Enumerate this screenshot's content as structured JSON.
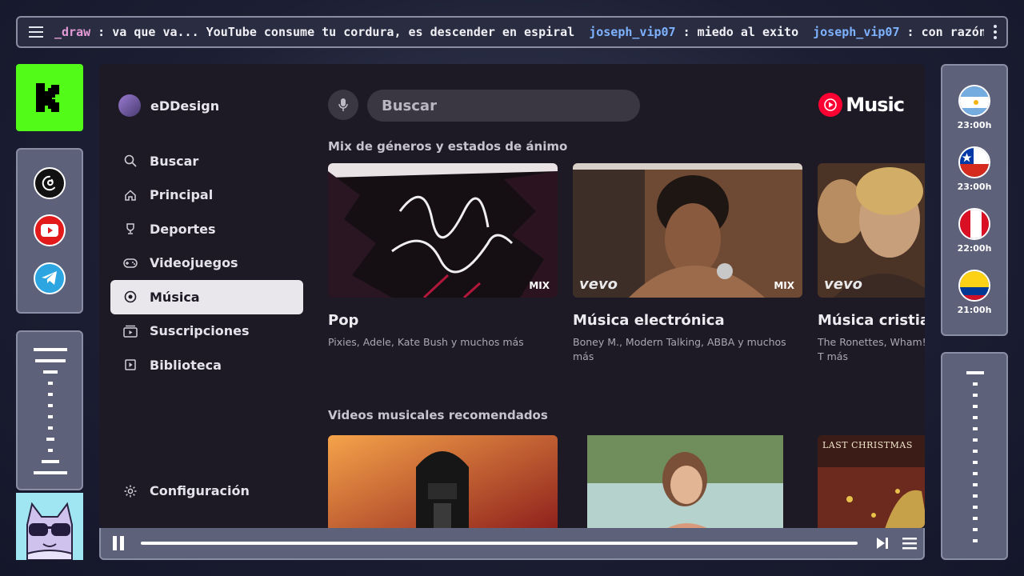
{
  "ticker": {
    "messages": [
      {
        "user": "_draw",
        "text": " : va que va... YouTube consume tu cordura, es descender en espiral"
      },
      {
        "user": "joseph_vip07",
        "text": " : miedo al exito"
      },
      {
        "user": "joseph_vip07",
        "text": " : con razón puso aja xd jajajaj"
      }
    ]
  },
  "schedule": [
    {
      "country": "argentina-flag",
      "time": "23:00h"
    },
    {
      "country": "chile-flag",
      "time": "23:00h"
    },
    {
      "country": "peru-flag",
      "time": "22:00h"
    },
    {
      "country": "colombia-flag",
      "time": "21:00h"
    }
  ],
  "app": {
    "account_name": "eDDesign",
    "search_placeholder": "Buscar",
    "brand": "Music",
    "nav": [
      {
        "label": "Buscar",
        "icon": "search-icon"
      },
      {
        "label": "Principal",
        "icon": "home-icon"
      },
      {
        "label": "Deportes",
        "icon": "trophy-icon"
      },
      {
        "label": "Videojuegos",
        "icon": "gamepad-icon"
      },
      {
        "label": "Música",
        "icon": "music-icon",
        "active": true
      },
      {
        "label": "Suscripciones",
        "icon": "subscriptions-icon"
      },
      {
        "label": "Biblioteca",
        "icon": "library-icon"
      }
    ],
    "settings_label": "Configuración",
    "section1_title": "Mix de géneros y estados de ánimo",
    "section2_title": "Videos musicales recomendados",
    "mix_badge": "MIX",
    "vevo": "vevo",
    "cards": [
      {
        "title": "Pop",
        "subtitle": "Pixies, Adele, Kate Bush y muchos más"
      },
      {
        "title": "Música electrónica",
        "subtitle": "Boney M., Modern Talking, ABBA y muchos más"
      },
      {
        "title": "Música cristian",
        "subtitle": "The Ronettes, Wham!, T más"
      }
    ],
    "video_thumb_text": "LAST CHRISTMAS"
  },
  "colors": {
    "kick": "#53fc18",
    "youtube": "#ff0033",
    "panel": "#5d6179"
  }
}
